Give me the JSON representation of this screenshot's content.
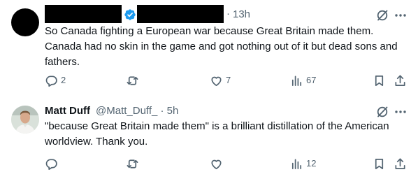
{
  "tweets": [
    {
      "display_name": "",
      "handle": "",
      "separator": "·",
      "time": "13h",
      "verified": true,
      "text": "So Canada fighting a European war because Great Britain made them. Canada had no skin in the game and got nothing out of it but dead sons and fathers.",
      "stats": {
        "replies": "2",
        "retweets": "",
        "likes": "7",
        "views": "67"
      }
    },
    {
      "display_name": "Matt Duff",
      "handle": "@Matt_Duff_",
      "separator": "·",
      "time": "5h",
      "meta_line": "@Matt_Duff_ · 5h",
      "verified": false,
      "text": "\"because Great Britain made them\" is a brilliant distillation of the American worldview. Thank you.",
      "stats": {
        "replies": "",
        "retweets": "",
        "likes": "",
        "views": "12"
      }
    }
  ],
  "icons": [
    "grok-icon",
    "more-icon",
    "reply-icon",
    "retweet-icon",
    "like-icon",
    "views-icon",
    "bookmark-icon",
    "share-icon",
    "verified-badge-icon"
  ],
  "colors": {
    "text": "#0f1419",
    "secondary": "#536471",
    "verified": "#1d9bf0",
    "background": "#ffffff"
  }
}
